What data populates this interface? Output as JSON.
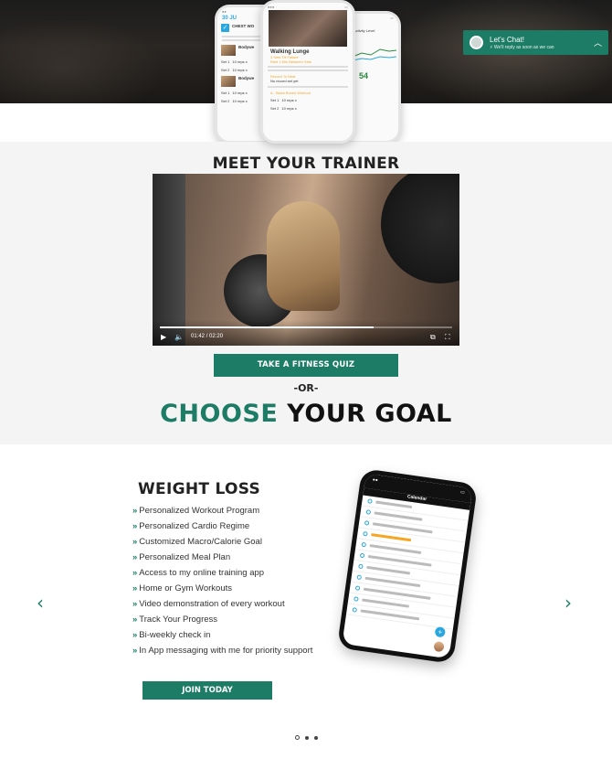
{
  "chat": {
    "title": "Let's Chat!",
    "subtitle": "We'll reply as soon as we can"
  },
  "hero_phones": {
    "left": {
      "date": "30 JU",
      "workout_title": "CHEST WO",
      "set1": "Set 1",
      "set1_value": "10 reps x",
      "set2": "Set 2",
      "set2_value": "10 reps x",
      "exercise": "Bodywe"
    },
    "center": {
      "exercise": "Walking Lunge",
      "tempo": "3 Sets Till Failure",
      "rest": "Rest 1 Min Between Sets",
      "section": "Record To Beat",
      "record": "No record set yet",
      "block": "A - Black Boxes Workout",
      "set1": "Set 1",
      "set2": "Set 2",
      "set_value": "10 reps x"
    },
    "right": {
      "label": "Activity Level",
      "value": "54"
    }
  },
  "trainer": {
    "heading": "MEET YOUR TRAINER",
    "video": {
      "current_time": "01:42",
      "duration": "02:20",
      "progress": 0.73,
      "time_separator": "/"
    },
    "quiz_button": "TAKE A FITNESS QUIZ",
    "or_text": "-OR-",
    "goal_highlight": "CHOOSE",
    "goal_rest": "YOUR GOAL"
  },
  "program": {
    "title": "WEIGHT LOSS",
    "features": [
      "Personalized Workout Program",
      "Personalized Cardio Regime",
      "Customized Macro/Calorie Goal",
      "Personalized Meal Plan",
      "Access to my online training app",
      "Home or Gym Workouts",
      "Video demonstration of every workout",
      "Track Your Progress",
      "Bi-weekly check in",
      "In App messaging with me for priority support"
    ],
    "join_button": "JOIN TODAY",
    "phone_header": "Calendar"
  },
  "carousel": {
    "prev_icon": "chevron-left-icon",
    "next_icon": "chevron-right-icon",
    "active_index": 0,
    "dot_count": 3
  },
  "colors": {
    "brand_green": "#1d7c65",
    "accent_blue": "#29a7df",
    "accent_orange": "#f5a623"
  }
}
